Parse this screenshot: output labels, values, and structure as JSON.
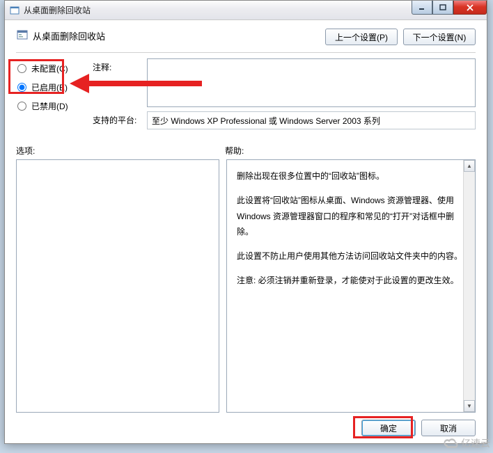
{
  "window": {
    "title": "从桌面删除回收站"
  },
  "header": {
    "title": "从桌面删除回收站",
    "prev": "上一个设置(P)",
    "next": "下一个设置(N)"
  },
  "radios": {
    "unconfigured": "未配置(C)",
    "enabled": "已启用(E)",
    "disabled": "已禁用(D)"
  },
  "labels": {
    "comment": "注释:",
    "platform": "支持的平台:",
    "options": "选项:",
    "help": "帮助:"
  },
  "platform": {
    "text": "至少 Windows XP Professional 或 Windows Server 2003 系列"
  },
  "help": {
    "p1": "删除出现在很多位置中的“回收站”图标。",
    "p2": "此设置将“回收站”图标从桌面、Windows 资源管理器、使用 Windows 资源管理器窗口的程序和常见的“打开”对话框中删除。",
    "p3": "此设置不防止用户使用其他方法访问回收站文件夹中的内容。",
    "p4": "注意: 必须注销并重新登录，才能使对于此设置的更改生效。"
  },
  "footer": {
    "ok": "确定",
    "cancel": "取消"
  },
  "watermark": {
    "text": "亿速云"
  },
  "win_controls": {
    "min": "minimize",
    "max": "maximize",
    "close": "close"
  }
}
